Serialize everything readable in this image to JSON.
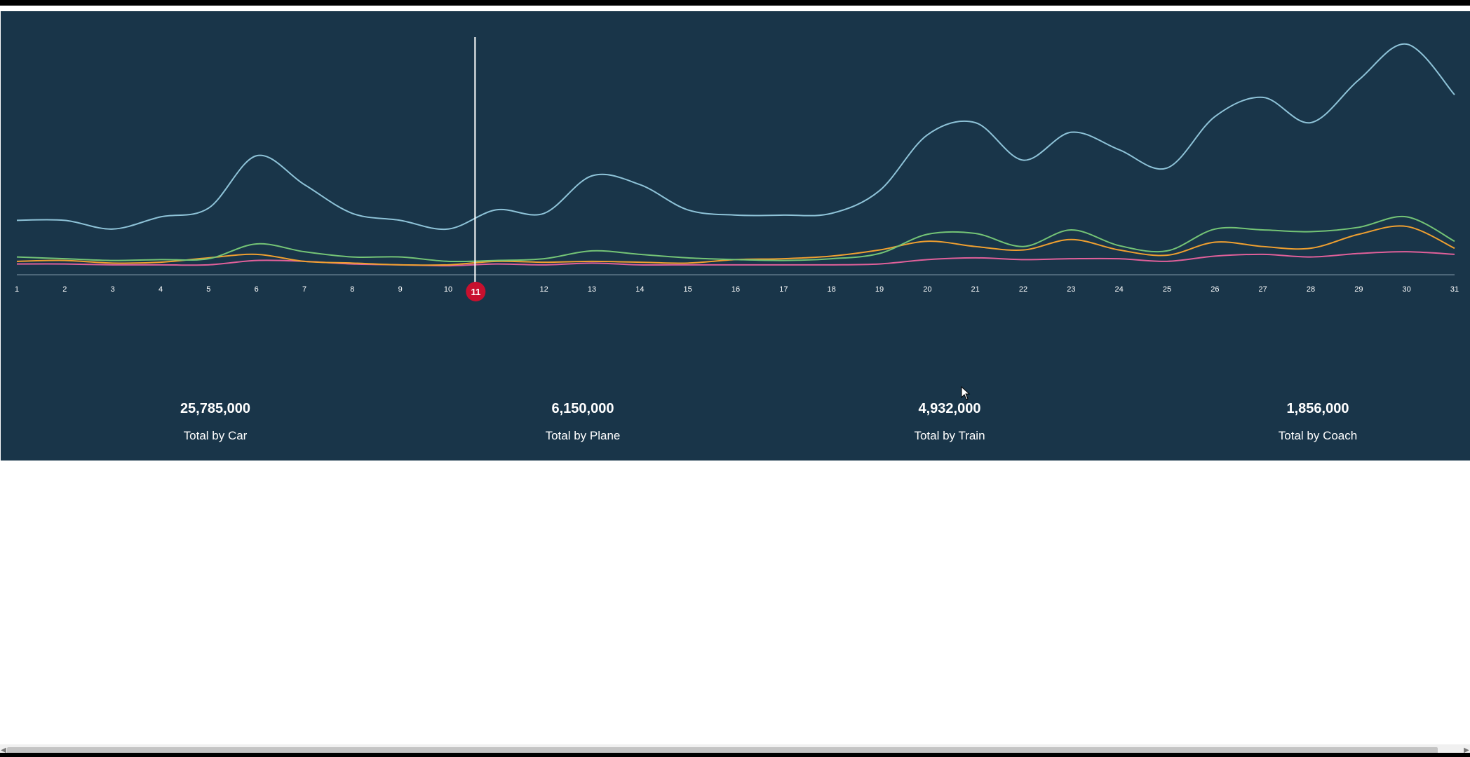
{
  "colors": {
    "background": "#193549",
    "axis": "#7f97a6",
    "playhead": "#ffffff",
    "badge": "#c8102e"
  },
  "chart_data": {
    "type": "line",
    "x": [
      1,
      2,
      3,
      4,
      5,
      6,
      7,
      8,
      9,
      10,
      11,
      12,
      13,
      14,
      15,
      16,
      17,
      18,
      19,
      20,
      21,
      22,
      23,
      24,
      25,
      26,
      27,
      28,
      29,
      30,
      31
    ],
    "xlim": [
      1,
      31
    ],
    "ylim": [
      0,
      2700
    ],
    "grid": false,
    "legend": "none",
    "series": [
      {
        "color": "#8ec3d8",
        "values": [
          640,
          640,
          540,
          680,
          780,
          1380,
          1050,
          720,
          640,
          540,
          760,
          720,
          1150,
          1050,
          760,
          700,
          700,
          720,
          980,
          1620,
          1760,
          1330,
          1650,
          1450,
          1240,
          1830,
          2050,
          1760,
          2250,
          2660,
          2080
        ]
      },
      {
        "color": "#74c476",
        "values": [
          220,
          200,
          180,
          190,
          200,
          370,
          280,
          220,
          220,
          170,
          180,
          200,
          290,
          250,
          210,
          190,
          180,
          200,
          260,
          480,
          490,
          340,
          530,
          350,
          290,
          540,
          530,
          510,
          560,
          680,
          400
        ]
      },
      {
        "color": "#f0a030",
        "values": [
          170,
          180,
          150,
          160,
          210,
          250,
          170,
          150,
          130,
          130,
          170,
          160,
          170,
          160,
          150,
          190,
          200,
          230,
          300,
          400,
          340,
          300,
          420,
          300,
          240,
          390,
          340,
          320,
          480,
          570,
          320
        ]
      },
      {
        "color": "#e0609a",
        "values": [
          140,
          140,
          130,
          130,
          130,
          180,
          170,
          140,
          130,
          120,
          140,
          130,
          150,
          130,
          130,
          130,
          130,
          130,
          140,
          190,
          210,
          190,
          200,
          200,
          170,
          230,
          250,
          220,
          260,
          280,
          250
        ]
      }
    ],
    "playhead_day": 11
  },
  "playhead": {
    "label": "11"
  },
  "stats": [
    {
      "value": "25,785,000",
      "label": "Total by Car"
    },
    {
      "value": "6,150,000",
      "label": "Total by Plane"
    },
    {
      "value": "4,932,000",
      "label": "Total by Train"
    },
    {
      "value": "1,856,000",
      "label": "Total by Coach"
    }
  ]
}
